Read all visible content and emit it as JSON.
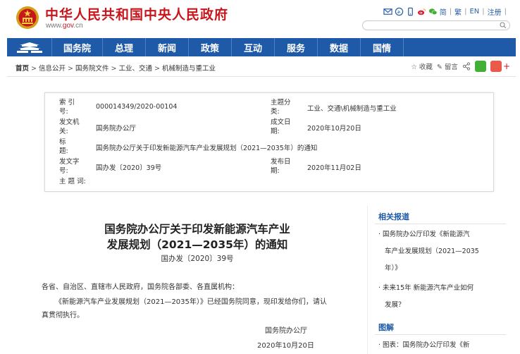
{
  "header": {
    "site_title": "中华人民共和国中央人民政府",
    "site_url_prefix": "www.",
    "site_url_accent": "gov",
    "site_url_suffix": ".cn",
    "lang_simplified": "简",
    "lang_traditional": "繁",
    "lang_english": "EN",
    "register": "注册",
    "separator": "|",
    "icons": [
      "mail-icon",
      "rss-icon",
      "mobile-icon",
      "weibo-icon",
      "wechat-icon"
    ],
    "search_placeholder": ""
  },
  "nav": {
    "items": [
      "国务院",
      "总理",
      "新闻",
      "政策",
      "互动",
      "服务",
      "数据",
      "国情"
    ]
  },
  "breadcrumb": {
    "items": [
      "首页",
      "信息公开",
      "国务院文件",
      "工业、交通",
      "机械制造与重工业"
    ],
    "separator": ">"
  },
  "tools": {
    "favorite": "收藏",
    "comment": "留言",
    "plus": "+"
  },
  "info": {
    "index_label": "索 引\n号:",
    "index_value": "000014349/2020-00104",
    "topic_label": "主题分\n类:",
    "topic_value": "工业、交通\\机械制造与重工业",
    "issuer_label": "发文机\n关:",
    "issuer_value": "国务院办公厅",
    "created_label": "成文日\n期:",
    "created_value": "2020年10月20日",
    "title_label": "标\n题:",
    "title_value": "国务院办公厅关于印发新能源汽车产业发展规划（2021—2035年）的通知",
    "docno_label": "发文字\n号:",
    "docno_value": "国办发〔2020〕39号",
    "published_label": "发布日\n期:",
    "published_value": "2020年11月02日",
    "keywords_label": "主 题 词:"
  },
  "article": {
    "title_line1": "国务院办公厅关于印发新能源汽车产业",
    "title_line2": "发展规划（2021—2035年）的通知",
    "doc_number": "国办发〔2020〕39号",
    "recipients": "各省、自治区、直辖市人民政府，国务院各部委、各直属机构：",
    "body_line1": "《新能源汽车产业发展规划（2021—2035年）》已经国务院同意，现印发给你们，请认",
    "body_line2": "真贯彻执行。",
    "signature": "国务院办公厅",
    "date": "2020年10月20日"
  },
  "sidebar": {
    "related_heading": "相关报道",
    "related_items": [
      [
        "· 国务院办公厅印发《新能源汽",
        "车产业发展规划（2021—2035",
        "年）》"
      ],
      [
        "· 未来15年 新能源汽车产业如何",
        "发展？"
      ]
    ],
    "graphic_heading": "图解",
    "graphic_items": [
      [
        "· 图表：国务院办公厅印发《新"
      ]
    ]
  },
  "colors": {
    "brand_red": "#c8161d",
    "nav_blue": "#1e5aa8",
    "link_blue": "#2a5fa6"
  }
}
